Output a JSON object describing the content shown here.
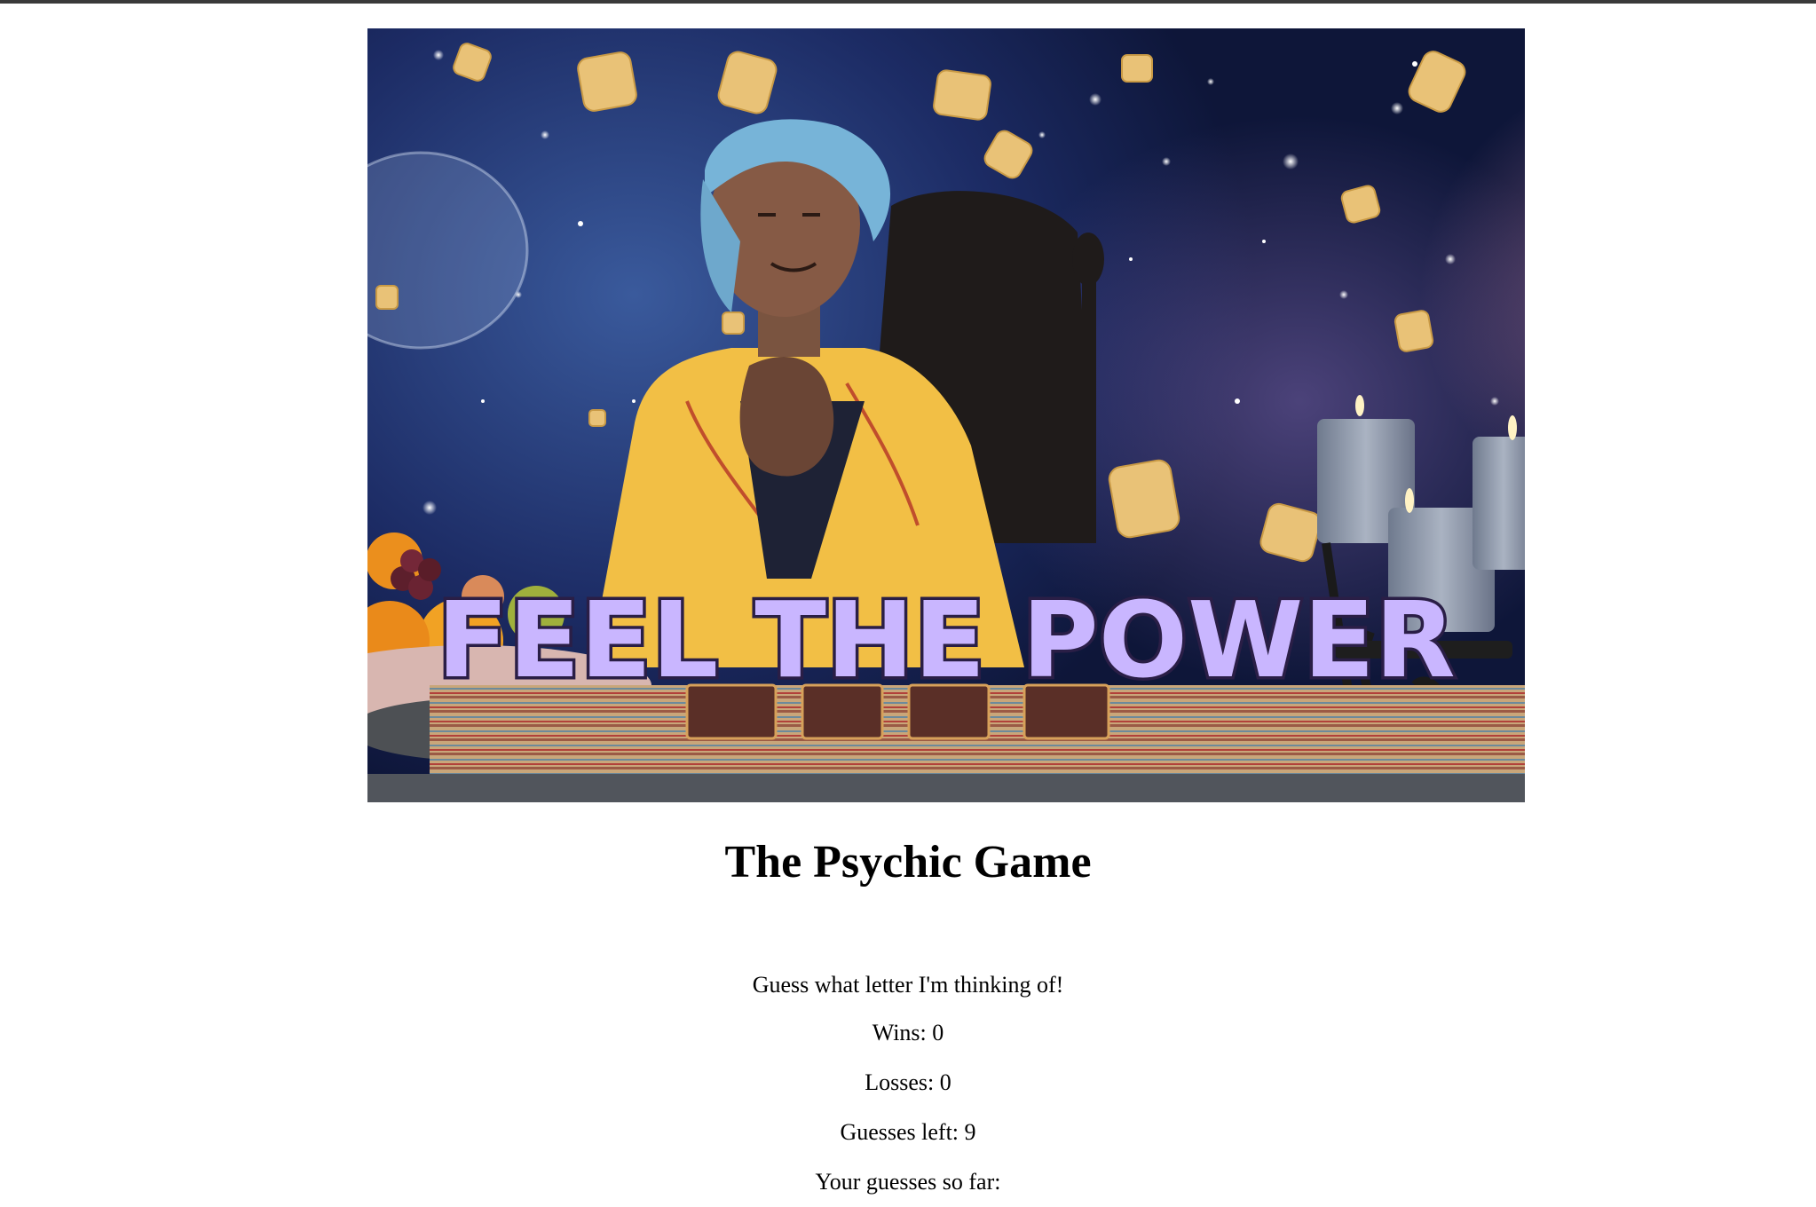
{
  "game": {
    "banner_text": "FEEL THE POWER",
    "title": "The Psychic Game",
    "instructions": "Guess what letter I'm thinking of!",
    "wins_label": "Wins: 0",
    "losses_label": "Losses: 0",
    "guesses_left_label": "Guesses left: 9",
    "guesses_so_far_label": "Your guesses so far:"
  },
  "colors": {
    "accent_banner": "#c9b6ff",
    "text": "#000000"
  }
}
